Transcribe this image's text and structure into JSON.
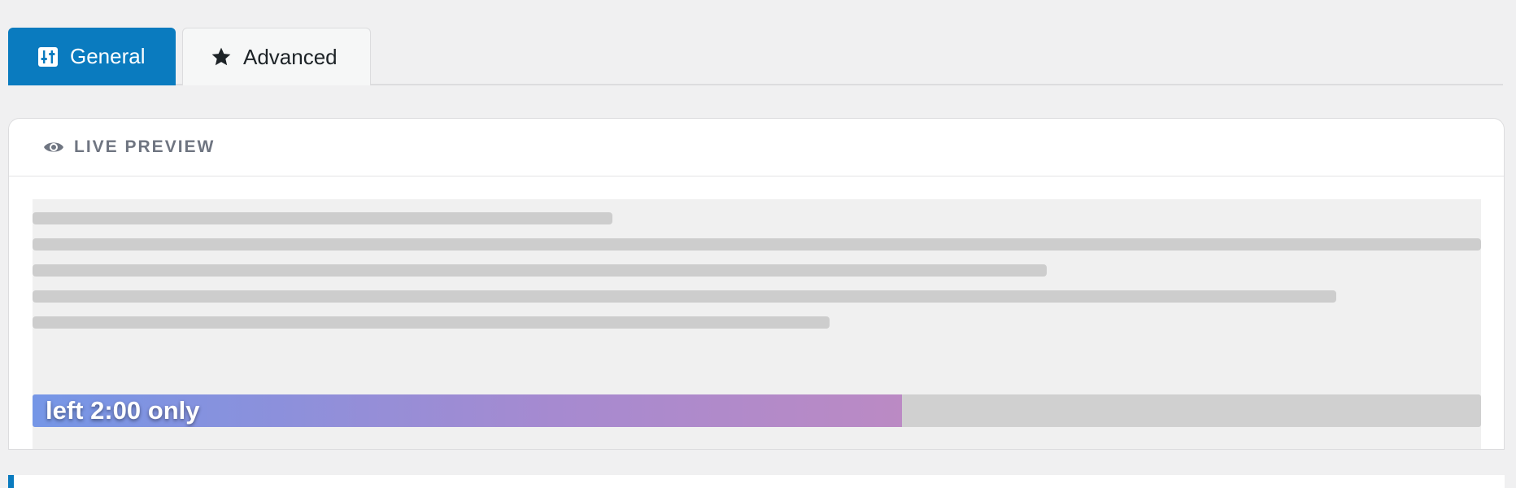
{
  "tabs": [
    {
      "label": "General",
      "icon": "sliders-icon",
      "active": true
    },
    {
      "label": "Advanced",
      "icon": "star-icon",
      "active": false
    }
  ],
  "preview": {
    "title": "LIVE PREVIEW",
    "icon": "eye-icon",
    "bar_label": "left 2:00 only",
    "bar_progress_percent": 60
  },
  "colors": {
    "accent": "#0a7bbf",
    "gradient_start": "#7596e6",
    "gradient_end": "#bb8ac4",
    "title_gray": "#6f7581"
  }
}
